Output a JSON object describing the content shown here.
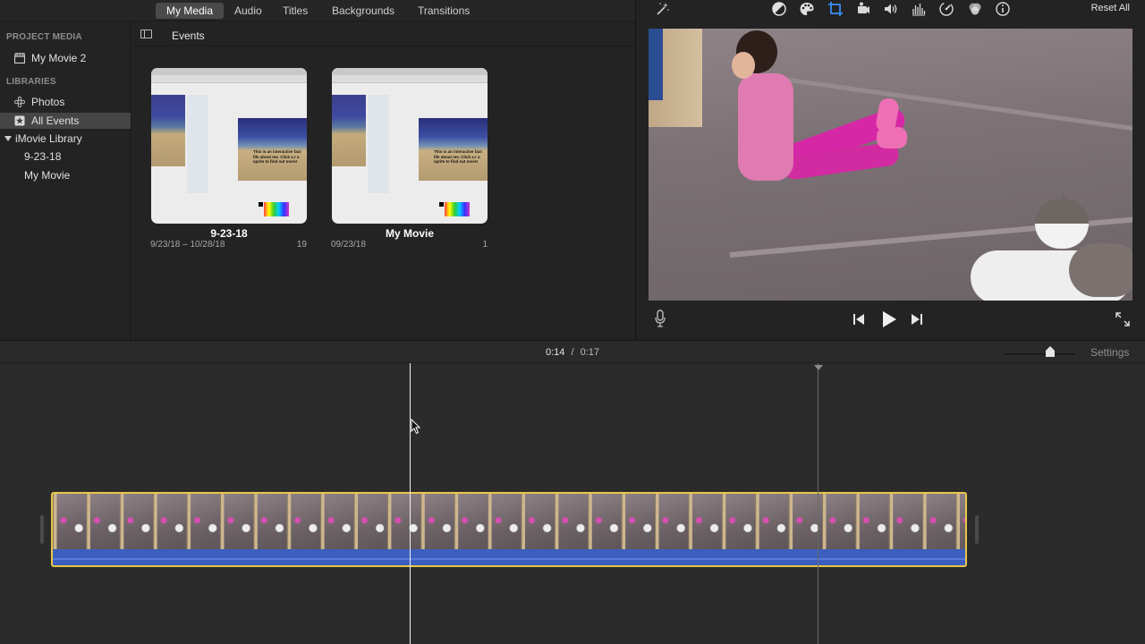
{
  "tabs": [
    "My Media",
    "Audio",
    "Titles",
    "Backgrounds",
    "Transitions"
  ],
  "sidebar": {
    "project_heading": "PROJECT MEDIA",
    "project_item": "My Movie 2",
    "libraries_heading": "LIBRARIES",
    "items": [
      {
        "label": "Photos",
        "icon": "photos-icon"
      },
      {
        "label": "All Events",
        "icon": "star-icon"
      },
      {
        "label": "iMovie Library",
        "icon": "disclosure-triangle-icon"
      },
      {
        "label": "9-23-18"
      },
      {
        "label": "My Movie"
      }
    ]
  },
  "browser": {
    "title": "Events",
    "events": [
      {
        "name": "9-23-18",
        "dates": "9/23/18 – 10/28/18",
        "count": "19",
        "thumb_text": "This is an interactive fact file about me. Click x.r a sprite to find out more!"
      },
      {
        "name": "My Movie",
        "dates": "09/23/18",
        "count": "1",
        "thumb_text": "This is an interactive fact file about me. Click x.r a sprite to find out more!"
      }
    ]
  },
  "viewer": {
    "reset_label": "Reset All",
    "tools": [
      "magic-wand-icon",
      "color-balance-icon",
      "color-correction-icon",
      "crop-icon",
      "stabilization-icon",
      "volume-icon",
      "equalizer-icon",
      "speed-icon",
      "clip-filter-icon",
      "info-icon"
    ]
  },
  "timeline": {
    "current_time": "0:14",
    "separator": "/",
    "total_time": "0:17",
    "settings_label": "Settings",
    "zoom_level": 0.65
  },
  "colors": {
    "clip_border": "#e8c64a",
    "audio_wave": "#3c5fbf",
    "active_tab": "#4a4a4a"
  }
}
